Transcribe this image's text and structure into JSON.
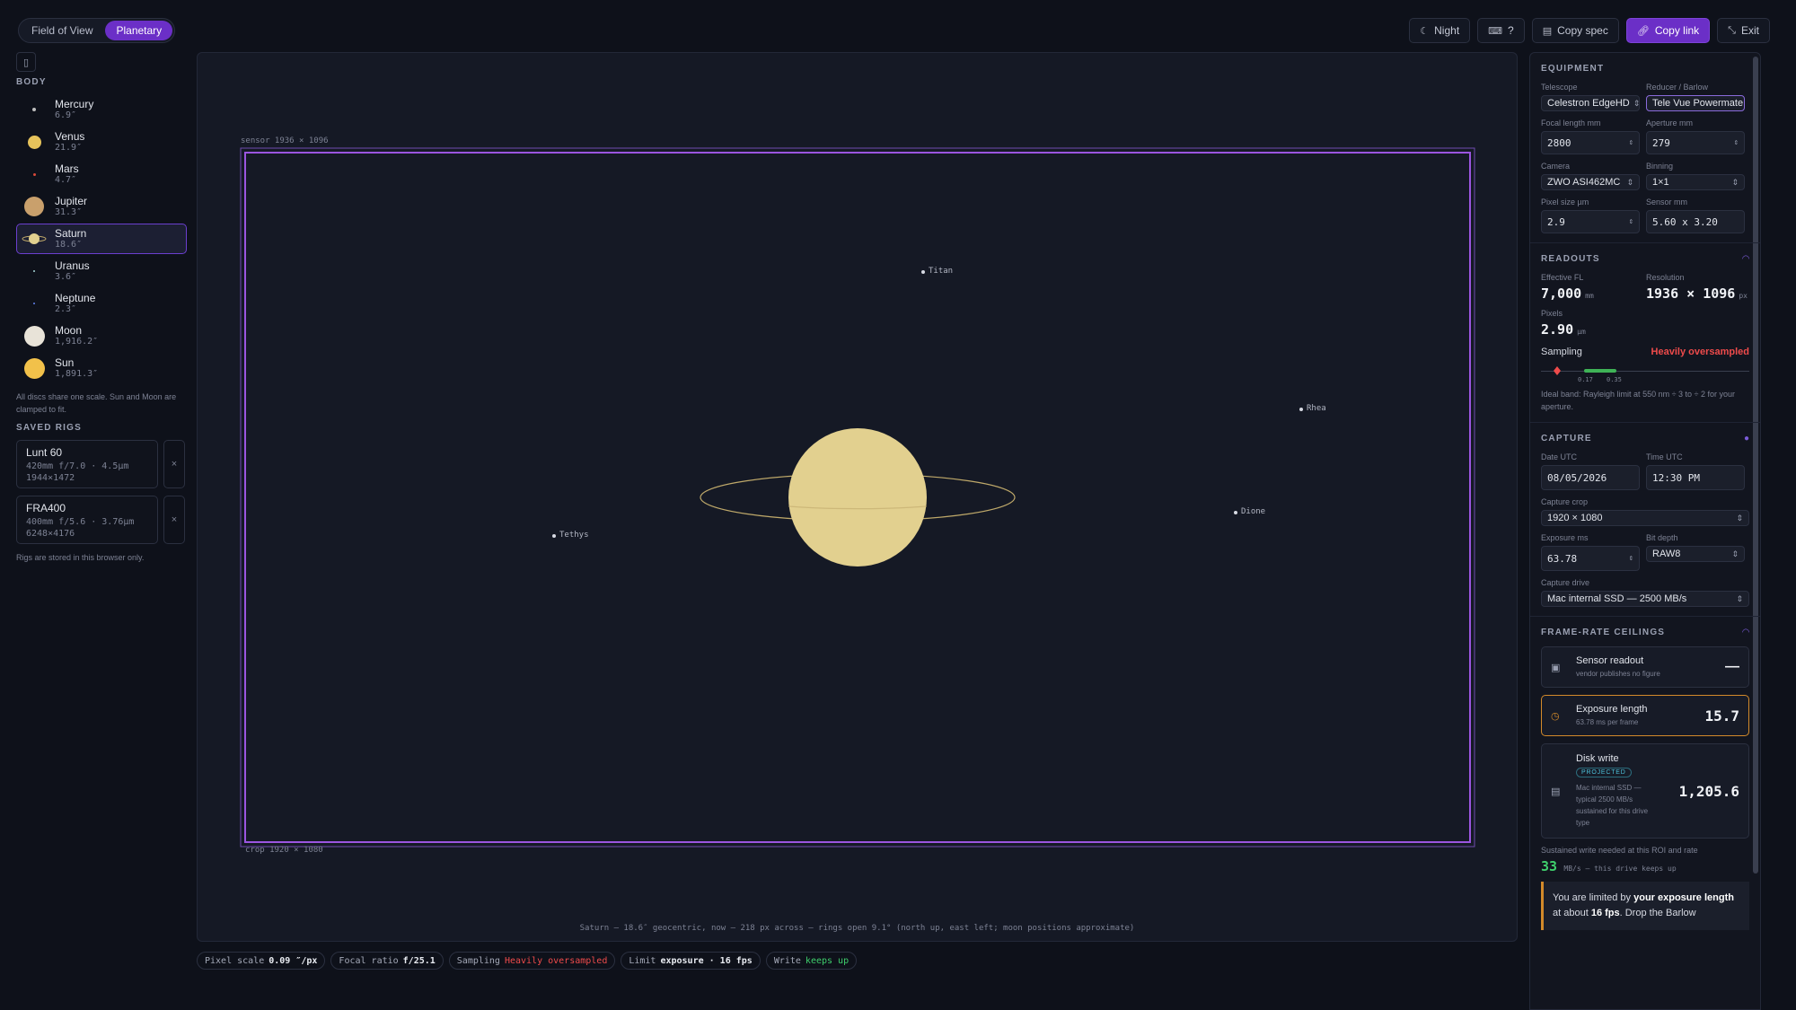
{
  "modes": [
    {
      "label": "Field of View"
    },
    {
      "label": "Planetary"
    }
  ],
  "top_actions": {
    "night": "Night",
    "help": "?",
    "copy_spec": "Copy spec",
    "copy_link": "Copy link",
    "exit": "Exit"
  },
  "sidebar": {
    "body_heading": "BODY",
    "bodies": [
      {
        "name": "Mercury",
        "size": "6.9″",
        "color": "#bdbdbd"
      },
      {
        "name": "Venus",
        "size": "21.9″",
        "color": "#e6c35b"
      },
      {
        "name": "Mars",
        "size": "4.7″",
        "color": "#d9493a"
      },
      {
        "name": "Jupiter",
        "size": "31.3″",
        "color": "#c9a06c"
      },
      {
        "name": "Saturn",
        "size": "18.6″",
        "color": "#e2d08f"
      },
      {
        "name": "Uranus",
        "size": "3.6″",
        "color": "#a8d8d8"
      },
      {
        "name": "Neptune",
        "size": "2.3″",
        "color": "#5876d8"
      },
      {
        "name": "Moon",
        "size": "1,916.2″",
        "color": "#e8e3d8"
      },
      {
        "name": "Sun",
        "size": "1,891.3″",
        "color": "#f2c14a"
      }
    ],
    "scale_note": "All discs share one scale. Sun and Moon are clamped to fit.",
    "saved_heading": "SAVED RIGS",
    "rigs": [
      {
        "name": "Lunt 60",
        "spec": "420mm f/7.0 · 4.5µm",
        "res": "1944×1472"
      },
      {
        "name": "FRA400",
        "spec": "400mm f/5.6 · 3.76µm",
        "res": "6248×4176"
      }
    ],
    "rigs_note": "Rigs are stored in this browser only."
  },
  "canvas": {
    "sensor_label": "sensor 1936 × 1096",
    "crop_label": "crop 1920 × 1080",
    "moons": [
      {
        "name": "Titan"
      },
      {
        "name": "Rhea"
      },
      {
        "name": "Dione"
      },
      {
        "name": "Tethys"
      }
    ],
    "caption": "Saturn — 18.6″ geocentric, now — 218 px across — rings open 9.1° (north up, east left; moon positions approximate)",
    "planet_color": "#e2d08f",
    "ring_color": "#bfa96a",
    "frame_color": "#9b55e0"
  },
  "status": {
    "pixel_scale_label": "Pixel scale",
    "pixel_scale": "0.09 ″/px",
    "focal_ratio_label": "Focal ratio",
    "focal_ratio": "f/25.1",
    "sampling_label": "Sampling",
    "sampling": "Heavily oversampled",
    "limit_label": "Limit",
    "limit": "exposure · 16 fps",
    "write_label": "Write",
    "write": "keeps up"
  },
  "equipment": {
    "heading": "EQUIPMENT",
    "telescope_label": "Telescope",
    "telescope": "Celestron EdgeHD",
    "reducer_label": "Reducer / Barlow",
    "reducer": "Tele Vue Powermate",
    "focal_label": "Focal length mm",
    "focal": "2800",
    "aperture_label": "Aperture mm",
    "aperture": "279",
    "camera_label": "Camera",
    "camera": "ZWO ASI462MC",
    "binning_label": "Binning",
    "binning": "1×1",
    "pixel_label": "Pixel size µm",
    "pixel": "2.9",
    "sensor_label": "Sensor mm",
    "sensor": "5.60 x 3.20"
  },
  "readouts": {
    "heading": "READOUTS",
    "efl_label": "Effective FL",
    "efl": "7,000",
    "efl_unit": "mm",
    "res_label": "Resolution",
    "res": "1936 × 1096",
    "res_unit": "px",
    "pixels_label": "Pixels",
    "pixels": "2.90",
    "pixels_unit": "µm",
    "sampling_label": "Sampling",
    "sampling": "Heavily oversampled",
    "band_low": "0.17",
    "band_high": "0.35",
    "note": "Ideal band: Rayleigh limit at 550 nm ÷ 3 to ÷ 2 for your aperture."
  },
  "capture": {
    "heading": "CAPTURE",
    "date_label": "Date UTC",
    "date": "08/05/2026",
    "time_label": "Time UTC",
    "time": "12:30 PM",
    "crop_label": "Capture crop",
    "crop": "1920 × 1080",
    "exposure_label": "Exposure ms",
    "exposure": "63.78",
    "bitdepth_label": "Bit depth",
    "bitdepth": "RAW8",
    "drive_label": "Capture drive",
    "drive": "Mac internal SSD — 2500 MB/s"
  },
  "ceilings": {
    "heading": "FRAME-RATE CEILINGS",
    "items": [
      {
        "title": "Sensor readout",
        "sub": "vendor publishes no figure",
        "value": "—"
      },
      {
        "title": "Exposure length",
        "sub": "63.78 ms per frame",
        "value": "15.7"
      },
      {
        "title": "Disk write",
        "badge": "PROJECTED",
        "sub": "Mac internal SSD — typical 2500 MB/s sustained for this drive type",
        "value": "1,205.6"
      }
    ],
    "write_needed_label": "Sustained write needed at this ROI and rate",
    "write_needed": "33",
    "write_needed_tail": "MB/s — this drive keeps up",
    "limit_msg_1": "You are limited by",
    "limit_msg_2": "your exposure length",
    "limit_msg_3": "at about",
    "limit_msg_4": "16 fps",
    "limit_msg_5": ". Drop the Barlow"
  }
}
